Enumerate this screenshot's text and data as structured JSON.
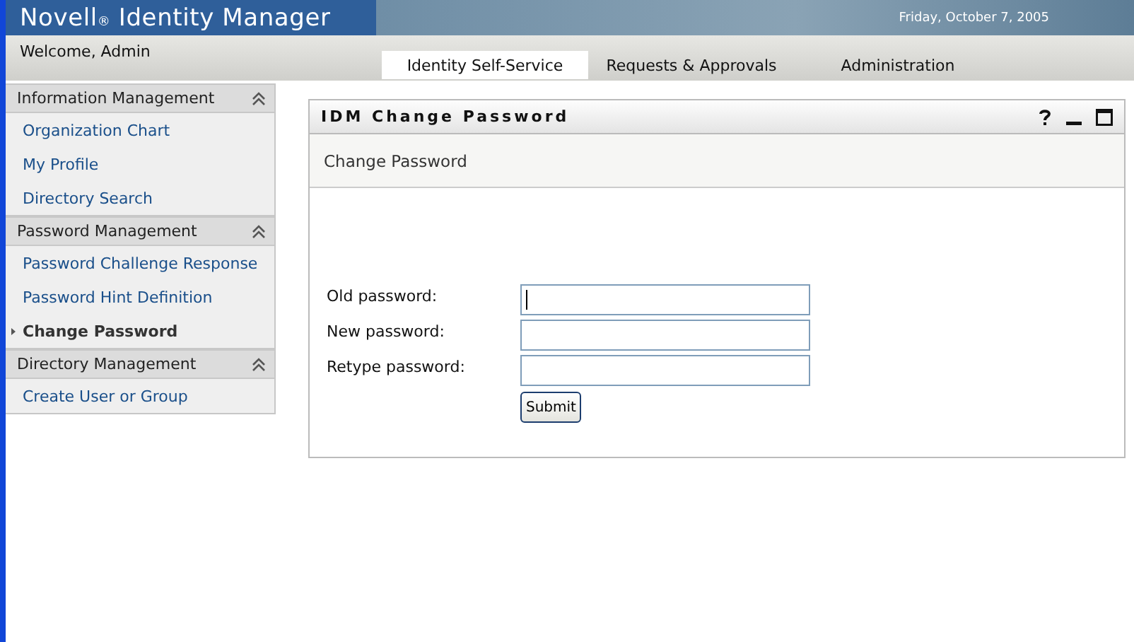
{
  "header": {
    "title": "Novell$_{®}$ Identity Manager",
    "date": "Friday, October 7, 2005"
  },
  "welcome": "Welcome, Admin",
  "tabs": [
    {
      "label": "Identity Self-Service",
      "selected": true
    },
    {
      "label": "Requests & Approvals",
      "selected": false
    },
    {
      "label": "Administration",
      "selected": false
    }
  ],
  "sidebar": {
    "sections": [
      {
        "title": "Information Management",
        "expanded": true,
        "items": [
          {
            "label": "Organization Chart",
            "selected": false
          },
          {
            "label": "My Profile",
            "selected": false
          },
          {
            "label": "Directory Search",
            "selected": false
          }
        ]
      },
      {
        "title": "Password Management",
        "expanded": true,
        "items": [
          {
            "label": "Password Challenge Response",
            "selected": false
          },
          {
            "label": "Password Hint Definition",
            "selected": false
          },
          {
            "label": "Change Password",
            "selected": true
          }
        ]
      },
      {
        "title": "Directory Management",
        "expanded": true,
        "items": [
          {
            "label": "Create User or Group",
            "selected": false
          }
        ]
      }
    ]
  },
  "panel": {
    "title": "IDM Change Password",
    "subtitle": "Change Password",
    "fields": [
      {
        "label": "Old password:",
        "focused": true
      },
      {
        "label": "New password:",
        "focused": false
      },
      {
        "label": "Retype password:",
        "focused": false
      }
    ],
    "submit": "Submit"
  }
}
